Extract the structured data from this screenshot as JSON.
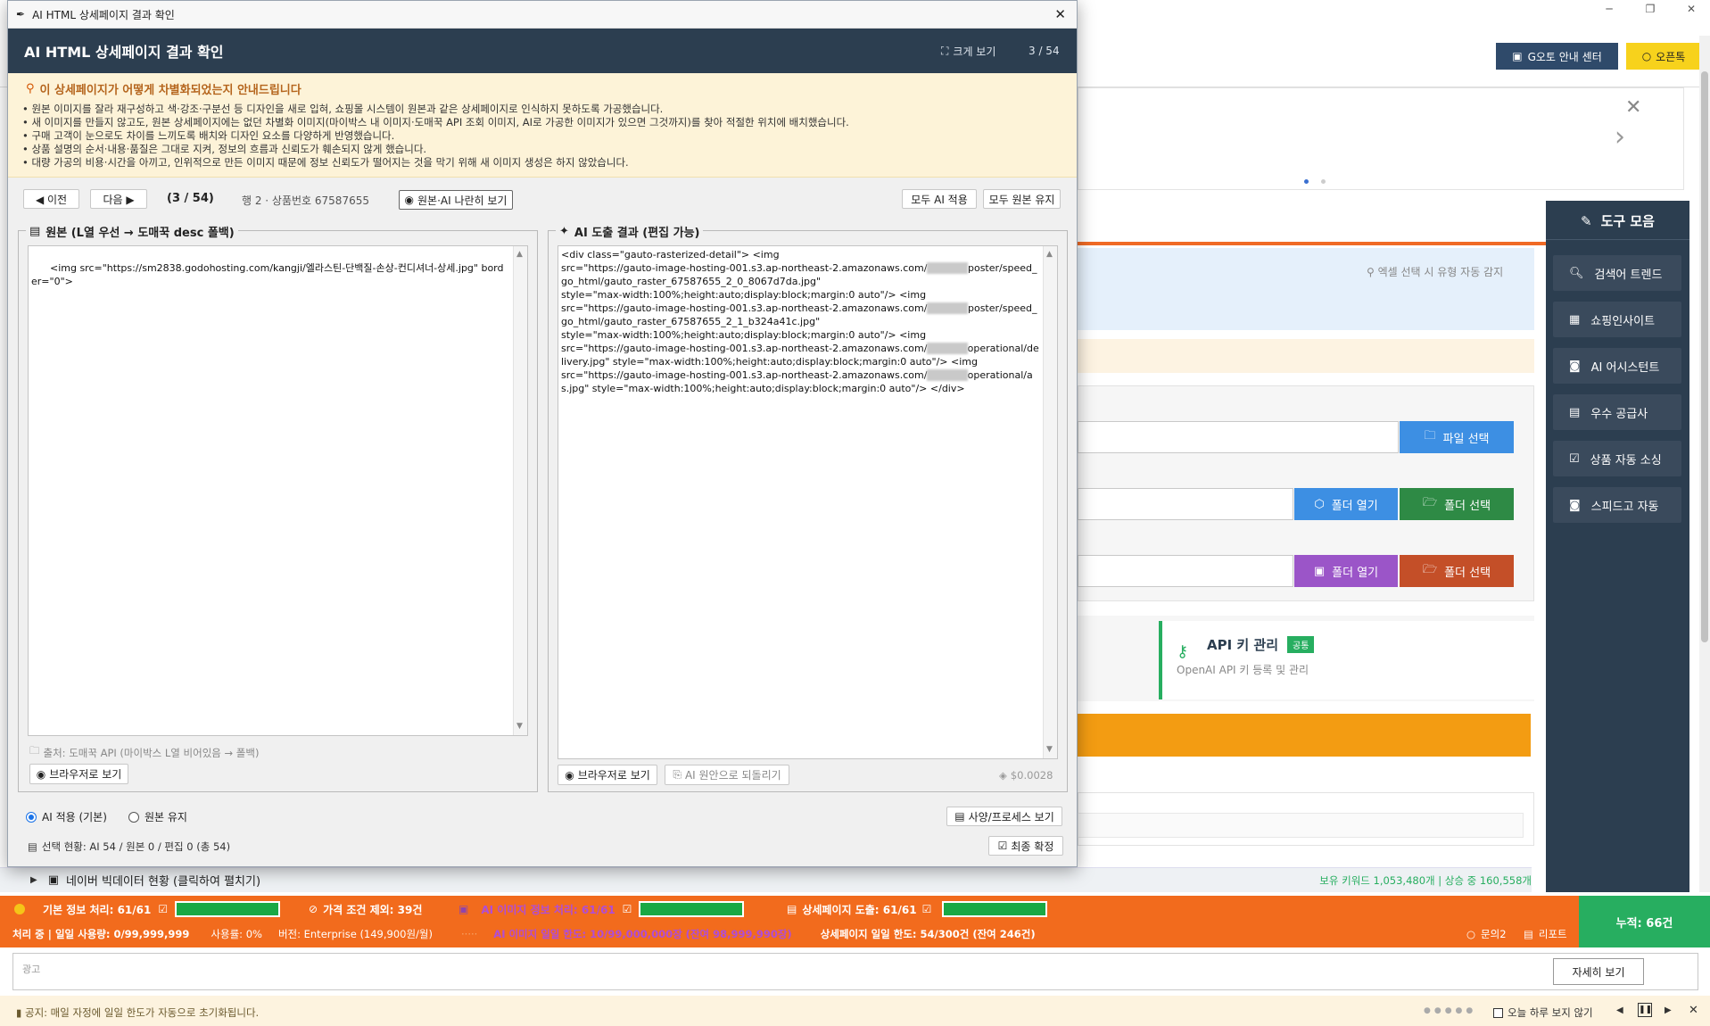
{
  "background_app": {
    "window_controls": {
      "minimize": "─",
      "maximize": "❐",
      "close": "✕"
    },
    "header_buttons": {
      "guide_center": "G오토 안내 센터",
      "open_chat": "오픈톡"
    },
    "banner": {
      "close": "✕",
      "next": "›"
    },
    "toolbox": {
      "title": "도구 모음",
      "items": [
        {
          "label": "검색어 트렌드",
          "icon": "search-icon"
        },
        {
          "label": "쇼핑인사이트",
          "icon": "chart-icon"
        },
        {
          "label": "AI 어시스턴트",
          "icon": "robot-icon"
        },
        {
          "label": "우수 공급사",
          "icon": "building-icon"
        },
        {
          "label": "상품 자동 소싱",
          "icon": "checkbox-icon"
        },
        {
          "label": "스피드고 자동",
          "icon": "robot-icon"
        }
      ]
    },
    "auto_detect_hint": "엑셀 선택 시 유형 자동 감지",
    "file_select": "파일 선택",
    "folder_open_1": "폴더 열기",
    "folder_select_1": "폴더 선택",
    "folder_open_2": "폴더 열기",
    "folder_select_2": "폴더 선택",
    "api_card": {
      "title": "API 키 관리",
      "badge": "공통",
      "desc": "OpenAI API 키 등록 및 관리"
    },
    "bigdata": {
      "label": "네이버 빅데이터 현황 (클릭하여 펼치기)",
      "stats": "보유 키워드 1,053,480개 | 상승 중 160,558개"
    },
    "status": {
      "basic": "기본 정보 처리: 61/61",
      "basic_progress": 1.0,
      "price_exclude": "가격 조건 제외: 39건",
      "ai_image": "AI 이미지 정보 처리: 61/61",
      "ai_image_progress": 1.0,
      "detail": "상세페이지 도출: 61/61",
      "detail_progress": 1.0,
      "processing": "처리 중 | 일일 사용량: 0/99,999,999",
      "usage": "사용률: 0%",
      "version": "버전: Enterprise (149,900원/월)",
      "ai_limit": "AI 이미지 일일 한도: 10/99,000,000장 (잔여 98,999,990장)",
      "detail_limit": "상세페이지 일일 한도: 54/300건 (잔여 246건)",
      "inquiry": "문의2",
      "report": "리포트",
      "cumulative": "누적: 66건"
    },
    "ad_label": "광고",
    "details_button": "자세히 보기",
    "notice": "공지: 매일 자정에 일일 한도가 자동으로 초기화됩니다.",
    "hide_today": "오늘 하루 보지 않기"
  },
  "dialog": {
    "window_title": "AI HTML 상세페이지 결과 확인",
    "close": "✕",
    "header_title": "AI HTML 상세페이지 결과 확인",
    "expand": "크게 보기",
    "page_counter": "3 / 54",
    "notice_title": "이 상세페이지가 어떻게 차별화되었는지 안내드립니다",
    "notice_lines": [
      "• 원본 이미지를 잘라 재구성하고 색·강조·구분선 등 디자인을 새로 입혀, 쇼핑몰 시스템이 원본과 같은 상세페이지로 인식하지 못하도록 가공했습니다.",
      "• 새 이미지를 만들지 않고도, 원본 상세페이지에는 없던 차별화 이미지(마이박스 내 이미지·도매꾹 API 조회 이미지, AI로 가공한 이미지가 있으면 그것까지)를 찾아 적절한 위치에 배치했습니다.",
      "• 구매 고객이 눈으로도 차이를 느끼도록 배치와 디자인 요소를 다양하게 반영했습니다.",
      "• 상품 설명의 순서·내용·품질은 그대로 지켜, 정보의 흐름과 신뢰도가 훼손되지 않게 했습니다.",
      "• 대량 가공의 비용·시간을 아끼고, 인위적으로 만든 이미지 때문에 정보 신뢰도가 떨어지는 것을 막기 위해 새 이미지 생성은 하지 않았습니다."
    ],
    "prev": "◀ 이전",
    "next": "다음 ▶",
    "position": "(3 / 54)",
    "row_info": "행 2 · 상품번호 67587655",
    "side_by_side": "원본·AI 나란히 보기",
    "all_ai": "모두 AI 적용",
    "all_original": "모두 원본 유지",
    "original_title": "원본 (L열 우선 → 도매꾹 desc 폴백)",
    "original_html": "<img src=\"https://sm2838.godohosting.com/kangji/엘라스틴-단백질-손상-컨디셔너-상세.jpg\" border=\"0\">",
    "source": "출처: 도매꾹 API (마이박스 L열 비어있음 → 폴백)",
    "view_browser_left": "브라우저로 보기",
    "ai_title": "AI 도출 결과 (편집 가능)",
    "ai_html_parts": [
      "<div class=\"gauto-rasterized-detail\"> <img\nsrc=\"https://gauto-image-hosting-001.s3.ap-northeast-2.amazonaws.com/",
      "poster/speed_go_html/gauto_raster_67587655_2_0_8067d7da.jpg\"\nstyle=\"max-width:100%;height:auto;display:block;margin:0 auto\"/> <img\nsrc=\"https://gauto-image-hosting-001.s3.ap-northeast-2.amazonaws.com/",
      "poster/speed_go_html/gauto_raster_67587655_2_1_b324a41c.jpg\"\nstyle=\"max-width:100%;height:auto;display:block;margin:0 auto\"/> <img\nsrc=\"https://gauto-image-hosting-001.s3.ap-northeast-2.amazonaws.com/",
      "operational/delivery.jpg\" style=\"max-width:100%;height:auto;display:block;margin:0 auto\"/> <img\nsrc=\"https://gauto-image-hosting-001.s3.ap-northeast-2.amazonaws.com/",
      "operational/as.jpg\" style=\"max-width:100%;height:auto;display:block;margin:0 auto\"/> </div>"
    ],
    "view_browser_right": "브라우저로 보기",
    "revert": "AI 원안으로 되돌리기",
    "cost": "$0.0028",
    "radio_ai": "AI 적용 (기본)",
    "radio_original": "원본 유지",
    "spec_view": "사양/프로세스 보기",
    "selection_status": "선택 현황: AI 54 / 원본 0 / 편집 0 (총 54)",
    "confirm": "최종 확정"
  }
}
